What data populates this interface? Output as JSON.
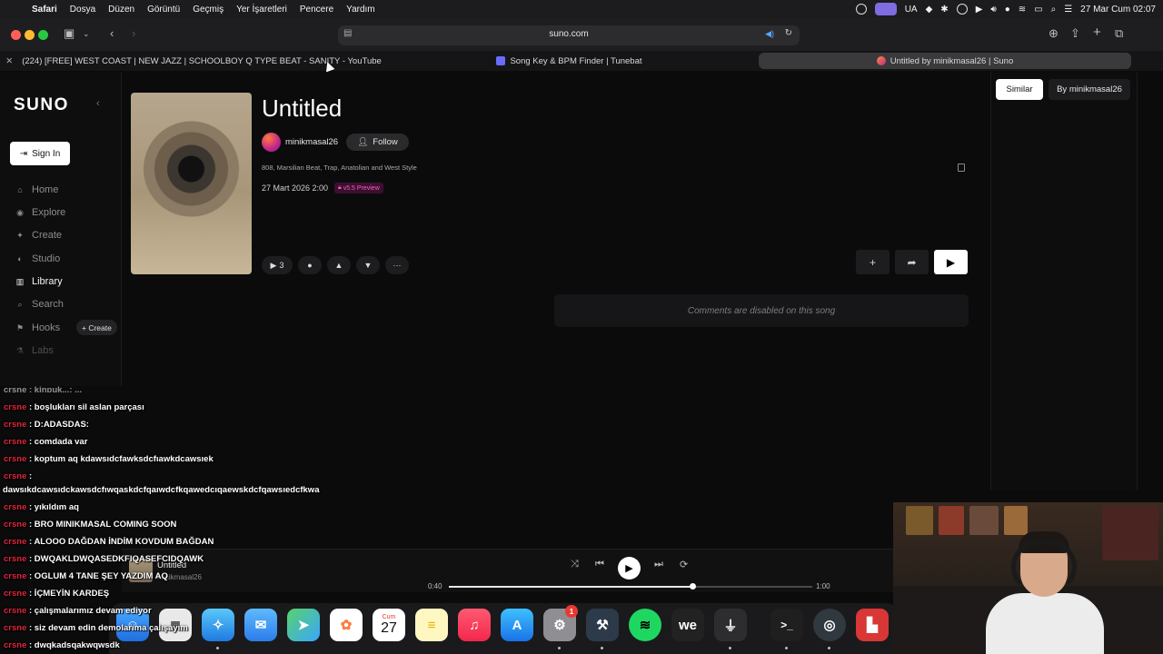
{
  "menubar": {
    "apple": "",
    "app": "Safari",
    "items": [
      "Dosya",
      "Düzen",
      "Görüntü",
      "Geçmiş",
      "Yer İşaretleri",
      "Pencere",
      "Yardım"
    ],
    "input_source": "UA",
    "datetime": "27 Mar Cum  02:07"
  },
  "browser": {
    "url": "suno.com",
    "tabs": [
      {
        "label": "(224) [FREE] WEST COAST | NEW JAZZ | SCHOOLBOY Q TYPE BEAT - SANITY - YouTube"
      },
      {
        "label": "Song Key & BPM Finder | Tunebat"
      },
      {
        "label": "Untitled by minikmasal26 | Suno"
      }
    ]
  },
  "sidebar": {
    "logo": "SUNO",
    "sign_in": "Sign In",
    "nav": [
      "Home",
      "Explore",
      "Create",
      "Studio",
      "Library",
      "Search",
      "Hooks"
    ],
    "create_pill": "+ Create",
    "labs": "Labs"
  },
  "song": {
    "title": "Untitled",
    "artist": "minikmasal26",
    "follow": "Follow",
    "tags": "808, Marsilian Beat, Trap, Anatolian and West Style",
    "date": "27 Mart 2026 2:00",
    "version": "v5.5 Preview",
    "plays": "3",
    "comments_disabled": "Comments are disabled on this song"
  },
  "right_panel": {
    "tabs": [
      "Similar",
      "By minikmasal26"
    ]
  },
  "chat": {
    "partial_top": "crsne : kinpuk...: ...",
    "lines": [
      {
        "user": "crsne",
        "text": " : boşlukları sil aslan parçası"
      },
      {
        "user": "crsne",
        "text": " : D:ADASDAS:"
      },
      {
        "user": "crsne",
        "text": " : comdada var"
      },
      {
        "user": "crsne",
        "text": " : koptum aq kdawsıdcfawksdcfıawkdcawsıek"
      },
      {
        "user": "crsne",
        "text": " :"
      },
      {
        "user": "",
        "text": "dawsıkdcawsıdckawsdcfıwqaskdcfqaıwdcfkqawedcıqaewskdcfqawsıedcfkwa"
      },
      {
        "user": "crsne",
        "text": " : yıkıldım aq"
      },
      {
        "user": "crsne",
        "text": " : BRO MINIKMASAL COMING SOON"
      },
      {
        "user": "crsne",
        "text": " : ALOOO DAĞDAN İNDİM KOVDUM BAĞDAN"
      },
      {
        "user": "crsne",
        "text": " : DWQAKLDWQASEDKFIQASEFCIDQAWK"
      },
      {
        "user": "crsne",
        "text": " : OGLUM 4 TANE ŞEY YAZDIM AQ"
      },
      {
        "user": "crsne",
        "text": " : İÇMEYİN KARDEŞ"
      },
      {
        "user": "crsne",
        "text": " : çalışmalarımız devam ediyor"
      },
      {
        "user": "crsne",
        "text": " : siz devam edin demolarıma çalışayım"
      },
      {
        "user": "crsne",
        "text": " : dwqkadsqakwqwsdk"
      }
    ]
  },
  "player": {
    "title": "Untitled",
    "artist": "minikmasal26",
    "elapsed": "0:40",
    "duration": "1:00",
    "progress": 0.67
  },
  "dock": {
    "calendar_month": "Cum",
    "calendar_day": "27",
    "settings_badge": "1"
  },
  "colors": {
    "accent_pink": "#ff5cb8",
    "chat_user": "#e0253b",
    "background": "#0b0b0c"
  }
}
